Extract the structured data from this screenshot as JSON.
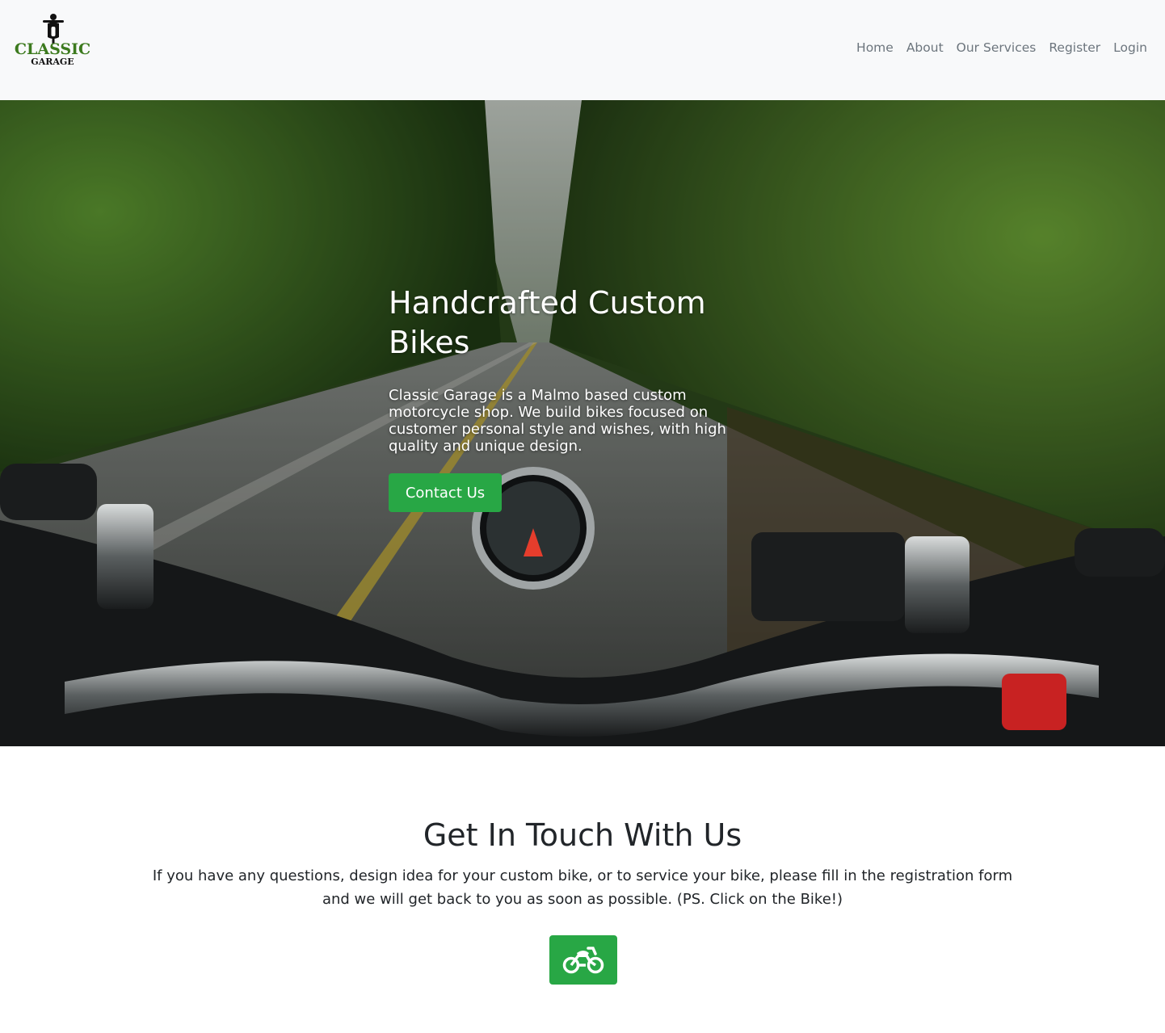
{
  "brand": {
    "line1": "CLASSIC",
    "line2": "GARAGE"
  },
  "nav": {
    "items": [
      {
        "label": "Home"
      },
      {
        "label": "About"
      },
      {
        "label": "Our Services"
      },
      {
        "label": "Register"
      },
      {
        "label": "Login"
      }
    ]
  },
  "hero": {
    "title": "Handcrafted Custom Bikes",
    "text": "Classic Garage is a Malmo based custom motorcycle shop. We build bikes focused on customer personal style and wishes, with high quality and unique design.",
    "button_label": "Contact Us"
  },
  "contact": {
    "title": "Get In Touch With Us",
    "text": "If you have any questions, design idea for your custom bike, or to service your bike, please fill in the registration form and we will get back to you as soon as possible. (PS. Click on the Bike!)",
    "button_icon": "motorcycle-icon"
  },
  "colors": {
    "accent": "#28a745",
    "navbar_bg": "#f8f9fa",
    "nav_link": "#6c757d",
    "logo_green": "#3c7a1e"
  }
}
